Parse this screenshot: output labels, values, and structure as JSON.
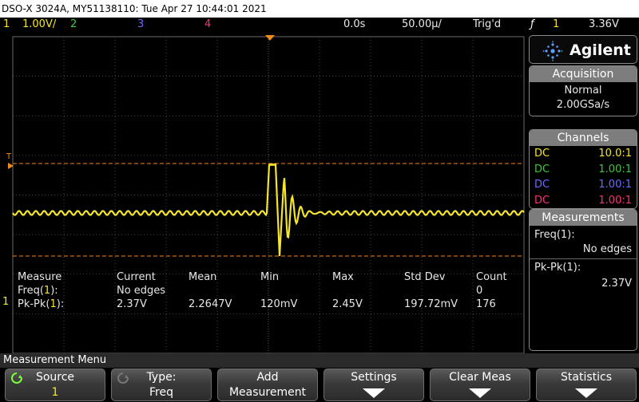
{
  "title_bar": {
    "text": "DSO-X 3024A, MY51138110: Tue Apr 27 10:44:01 2021"
  },
  "status_bar": {
    "ch1_num": "1",
    "ch1_scale": "1.00V/",
    "ch2_num": "2",
    "ch3_num": "3",
    "ch4_num": "4",
    "time_delay": "0.0s",
    "time_scale": "50.00µ/",
    "trigger_status": "Trig'd",
    "trigger_edge_symbol": "ƒ",
    "trigger_source": "1",
    "trigger_level": "3.36V"
  },
  "colors": {
    "ch1": "#f5e62a",
    "ch2": "#3ec83e",
    "ch3": "#6a6aff",
    "ch4": "#ff2e7a",
    "trigger_marker": "#f08a1a",
    "grid": "#5f5f5f"
  },
  "waveform": {
    "channel": 1,
    "pk_pk_volts": 2.37,
    "min_volts": 0.12,
    "max_volts": 2.45
  },
  "side_panel": {
    "brand": "Agilent",
    "acquisition": {
      "header": "Acquisition",
      "mode": "Normal",
      "rate": "2.00GSa/s"
    },
    "channels": {
      "header": "Channels",
      "rows": [
        {
          "coupling": "DC",
          "probe": "10.0:1"
        },
        {
          "coupling": "DC",
          "probe": "1.00:1"
        },
        {
          "coupling": "DC",
          "probe": "1.00:1"
        },
        {
          "coupling": "DC",
          "probe": "1.00:1"
        }
      ]
    },
    "measurements": {
      "header": "Measurements",
      "freq_label": "Freq(1):",
      "freq_value": "No edges",
      "pkpk_label": "Pk-Pk(1):",
      "pkpk_value": "2.37V"
    }
  },
  "measurement_table": {
    "headers": [
      "Measure",
      "Current",
      "Mean",
      "Min",
      "Max",
      "Std Dev",
      "Count"
    ],
    "rows": [
      [
        "Freq(1):",
        "No edges",
        "",
        "",
        "",
        "",
        "0"
      ],
      [
        "Pk-Pk(1):",
        "2.37V",
        "2.2647V",
        "120mV",
        "2.45V",
        "197.72mV",
        "176"
      ]
    ]
  },
  "markers": {
    "trigger_level_label": "T",
    "ground_label": "1"
  },
  "menu": {
    "title": "Measurement Menu",
    "softkeys": [
      {
        "line1": "Source",
        "line2": "1",
        "icon": "rotate-knob-icon"
      },
      {
        "line1": "Type:",
        "line2": "Freq",
        "icon": "rotate-knob-icon"
      },
      {
        "line1": "Add",
        "line2": "Measurement",
        "icon": ""
      },
      {
        "line1": "Settings",
        "line2": "",
        "icon": "down-arrow-icon"
      },
      {
        "line1": "Clear Meas",
        "line2": "",
        "icon": "down-arrow-icon"
      },
      {
        "line1": "Statistics",
        "line2": "",
        "icon": "down-arrow-icon"
      }
    ]
  }
}
